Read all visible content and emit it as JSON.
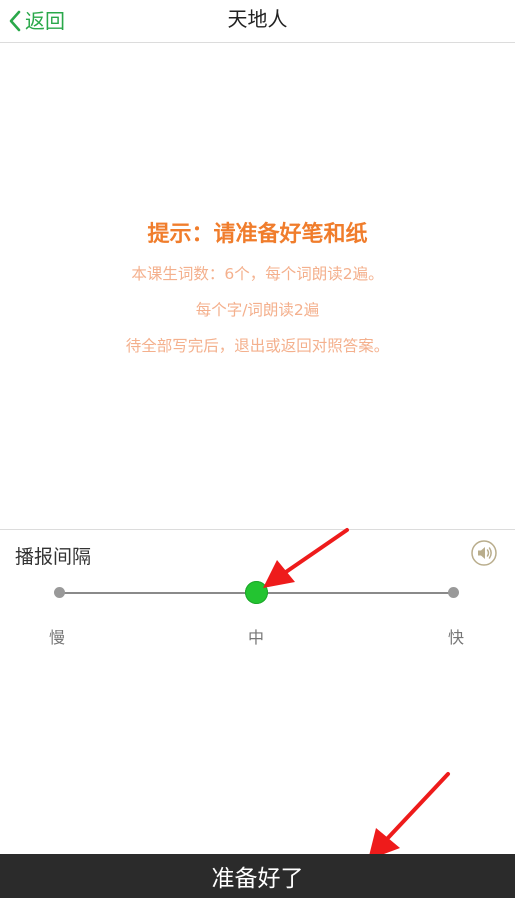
{
  "header": {
    "back_label": "返回",
    "title": "天地人",
    "accent_color": "#2aa84a"
  },
  "hint": {
    "title": "提示：请准备好笔和纸",
    "lines": [
      "本课生词数：6个，每个词朗读2遍。",
      "每个字/词朗读2遍",
      "待全部写完后，退出或返回对照答案。"
    ],
    "title_color": "#f07d2c",
    "line_color": "#f4b08d"
  },
  "settings": {
    "label": "播报间隔",
    "speaker_icon": "speaker-icon",
    "slider": {
      "options": [
        "慢",
        "中",
        "快"
      ],
      "selected": "中",
      "selected_index": 1,
      "thumb_color": "#23c431"
    }
  },
  "footer": {
    "ready_label": "准备好了"
  }
}
